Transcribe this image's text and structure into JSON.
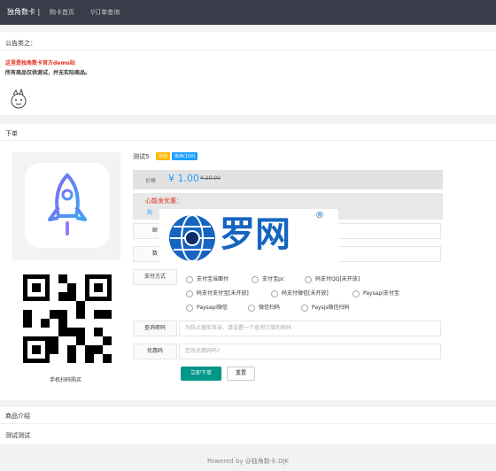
{
  "nav": {
    "brand": "独角数卡 |",
    "home": "购卡首页",
    "order_query": "订单查询"
  },
  "notice": {
    "title": "公告类之：",
    "line1": "这里是独角数卡官方demo站",
    "line2": "所有商品仅供测试，并无实际商品。"
  },
  "order": {
    "section_title": "下单",
    "product_name": "测试5",
    "tag_auto": "自动",
    "tag_stock": "库存(100)",
    "price_label": "价格",
    "price": "¥ 1.00",
    "old_price": "¥ 20.00",
    "promo_title": "心能发优惠：",
    "promo_text": "购",
    "email_label": "邮",
    "qty_label": "数",
    "pay_label": "支付方式",
    "pay_options": [
      "支付宝当面付",
      "支付宝pc",
      "码支付QQ[未开放]",
      "码支付支付宝[未开放]",
      "码支付微信[未开放]",
      "Paysapi支付宝",
      "Paysapi微信",
      "微信扫码",
      "Paysjs微信扫码"
    ],
    "query_pwd_label": "查询密码",
    "query_pwd_placeholder": "为防止撞库攻击，请设置一个查询订单的密码",
    "coupon_label": "优惠码",
    "coupon_placeholder": "您有优惠码吗?",
    "submit": "立即下单",
    "reset": "重置",
    "qr_caption": "手机扫码购买"
  },
  "watermark": {
    "text": "罗网",
    "reg": "®"
  },
  "intro": {
    "title": "商品介绍",
    "content": "测试测试"
  },
  "footer": "Powered by @独角数卡.DJK"
}
